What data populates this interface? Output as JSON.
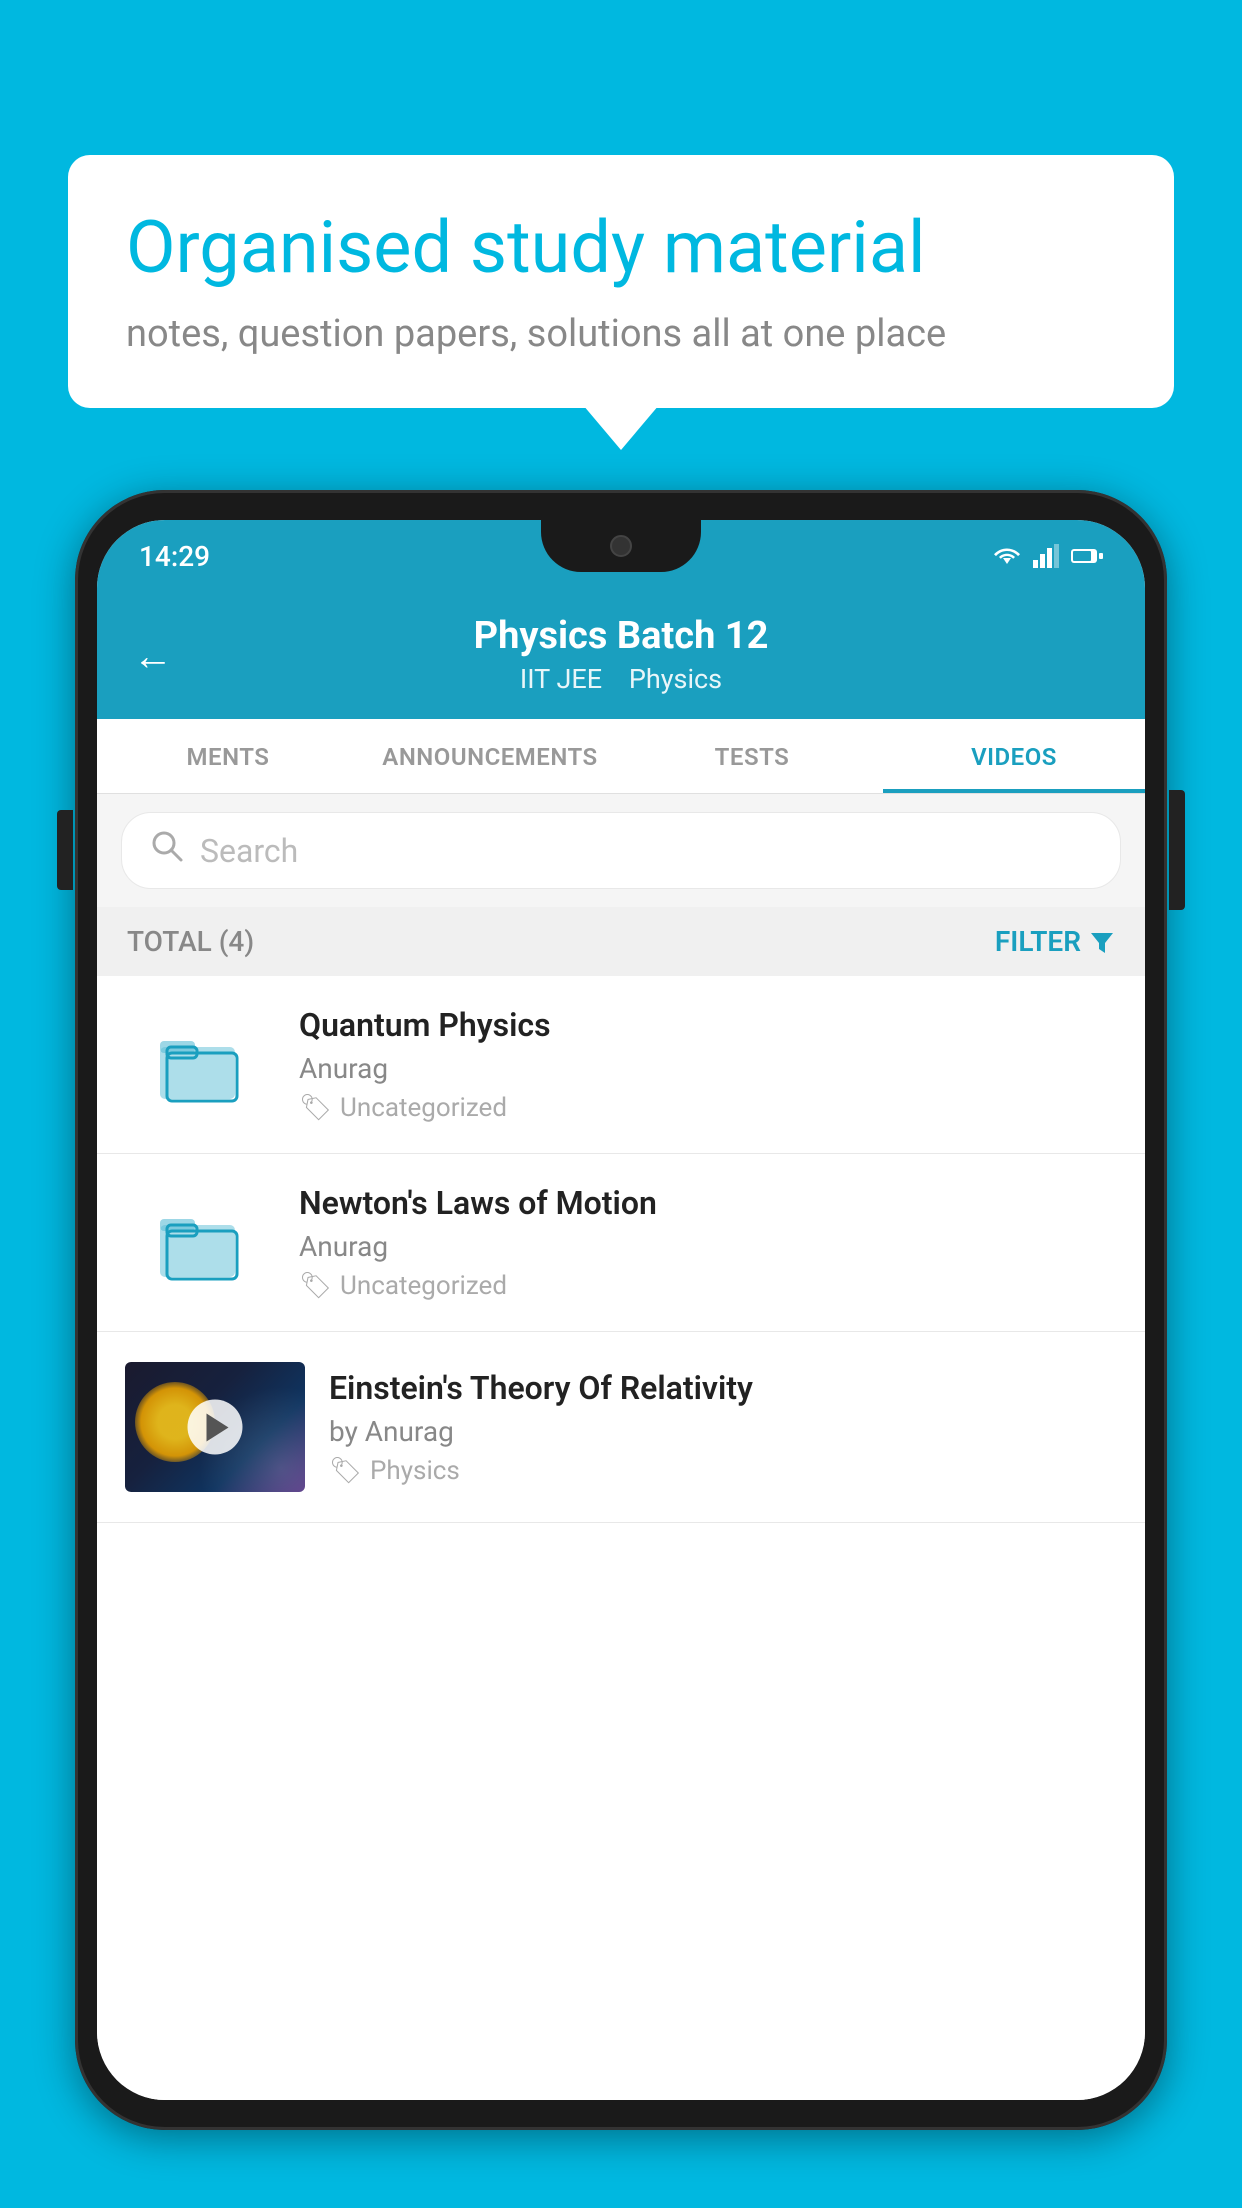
{
  "background_color": "#00B8E0",
  "speech_bubble": {
    "title": "Organised study material",
    "subtitle": "notes, question papers, solutions all at one place"
  },
  "status_bar": {
    "time": "14:29",
    "wifi_icon": "wifi-icon",
    "signal_icon": "signal-icon",
    "battery_icon": "battery-icon"
  },
  "app_header": {
    "back_label": "←",
    "title": "Physics Batch 12",
    "subtitle_1": "IIT JEE",
    "subtitle_2": "Physics"
  },
  "tabs": [
    {
      "label": "MENTS",
      "active": false
    },
    {
      "label": "ANNOUNCEMENTS",
      "active": false
    },
    {
      "label": "TESTS",
      "active": false
    },
    {
      "label": "VIDEOS",
      "active": true
    }
  ],
  "search": {
    "placeholder": "Search"
  },
  "filter_row": {
    "total_label": "TOTAL (4)",
    "filter_label": "FILTER"
  },
  "videos": [
    {
      "title": "Quantum Physics",
      "author": "Anurag",
      "tag": "Uncategorized",
      "has_thumb": false,
      "has_play": false
    },
    {
      "title": "Newton's Laws of Motion",
      "author": "Anurag",
      "tag": "Uncategorized",
      "has_thumb": false,
      "has_play": false
    },
    {
      "title": "Einstein's Theory Of Relativity",
      "author": "by Anurag",
      "tag": "Physics",
      "has_thumb": true,
      "has_play": true
    }
  ]
}
